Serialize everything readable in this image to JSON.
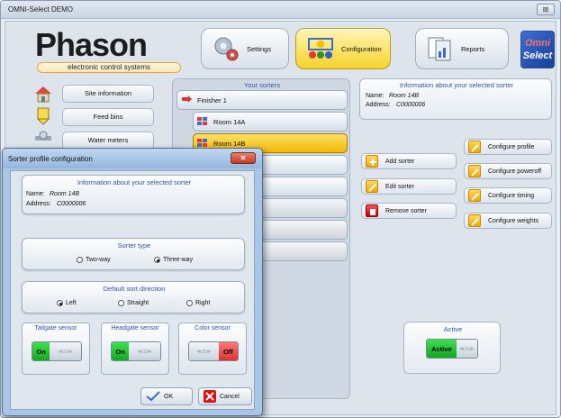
{
  "window": {
    "title": "OMNI-Select DEMO",
    "close_glyph": "⊠"
  },
  "header": {
    "logo_text": "Phason",
    "logo_subtitle": "electronic control systems",
    "tabs": [
      {
        "label": "Settings",
        "icon": "gears-icon",
        "active": false
      },
      {
        "label": "Configuration",
        "icon": "configuration-icon",
        "active": true
      },
      {
        "label": "Reports",
        "icon": "reports-icon",
        "active": false
      }
    ],
    "brand_logo": {
      "line1": "Omni",
      "line2": "Select"
    }
  },
  "sidebar": {
    "items": [
      {
        "label": "Site information",
        "icon": "house-icon"
      },
      {
        "label": "Feed bins",
        "icon": "feed-bin-icon"
      },
      {
        "label": "Water meters",
        "icon": "water-meter-icon"
      }
    ]
  },
  "sorters": {
    "title": "Your sorters",
    "rows": [
      {
        "label": "Finisher 1",
        "kind": "group"
      },
      {
        "label": "Room 14A",
        "kind": "sorter"
      },
      {
        "label": "Room 14B",
        "kind": "sorter",
        "selected": true
      }
    ]
  },
  "info": {
    "title": "Information about your selected sorter",
    "name_label": "Name:",
    "name_value": "Room 14B",
    "address_label": "Address:",
    "address_value": "C0000006"
  },
  "actions": {
    "add": "Add sorter",
    "edit": "Edit sorter",
    "remove": "Remove sorter",
    "configure_profile": "Configure profile",
    "configure_poweroff": "Configure poweroff",
    "configure_timing": "Configure timing",
    "configure_weights": "Configure weights"
  },
  "active": {
    "title": "Active",
    "state_label": "Active",
    "handle": "≪≡≫"
  },
  "dialog": {
    "title": "Sorter profile configuration",
    "close_glyph": "✕",
    "info": {
      "title": "Information about your selected sorter",
      "name_label": "Name:",
      "name_value": "Room 14B",
      "address_label": "Address:",
      "address_value": "C0000006"
    },
    "sorter_type": {
      "title": "Sorter type",
      "options": [
        "Two-way",
        "Three-way"
      ],
      "selected": "Three-way"
    },
    "sort_direction": {
      "title": "Default sort direction",
      "options": [
        "Left",
        "Straight",
        "Right"
      ],
      "selected": "Left"
    },
    "sensors": [
      {
        "title": "Tailgate sensor",
        "state": "On"
      },
      {
        "title": "Headgate sensor",
        "state": "On"
      },
      {
        "title": "Color sensor",
        "state": "Off"
      }
    ],
    "handle": "≪≡≫",
    "ok_label": "OK",
    "cancel_label": "Cancel"
  }
}
